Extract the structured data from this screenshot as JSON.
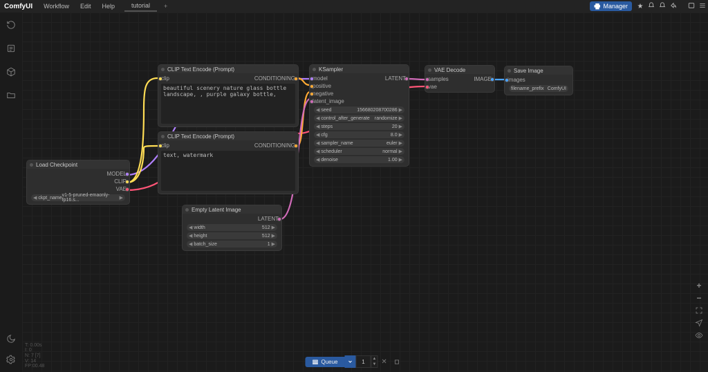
{
  "menu": {
    "logo": "ComfyUI",
    "items": [
      "Workflow",
      "Edit",
      "Help"
    ],
    "tab": "tutorial",
    "manager": "Manager"
  },
  "sidebar": {},
  "nodes": {
    "ckpt": {
      "title": "Load Checkpoint",
      "outputs": [
        "MODEL",
        "CLIP",
        "VAE"
      ],
      "widget": {
        "label": "ckpt_name",
        "value": "v1-5-pruned-emaonly-fp16.s..."
      }
    },
    "clip1": {
      "title": "CLIP Text Encode (Prompt)",
      "in_label": "clip",
      "out_label": "CONDITIONING",
      "text": "beautiful scenery nature glass bottle landscape, , purple galaxy bottle,"
    },
    "clip2": {
      "title": "CLIP Text Encode (Prompt)",
      "in_label": "clip",
      "out_label": "CONDITIONING",
      "text": "text, watermark"
    },
    "empty": {
      "title": "Empty Latent Image",
      "out_label": "LATENT",
      "widgets": [
        {
          "label": "width",
          "value": "512"
        },
        {
          "label": "height",
          "value": "512"
        },
        {
          "label": "batch_size",
          "value": "1"
        }
      ]
    },
    "ksampler": {
      "title": "KSampler",
      "inputs": [
        "model",
        "positive",
        "negative",
        "latent_image"
      ],
      "out_label": "LATENT",
      "widgets": [
        {
          "label": "seed",
          "value": "156680208700286"
        },
        {
          "label": "control_after_generate",
          "value": "randomize"
        },
        {
          "label": "steps",
          "value": "20"
        },
        {
          "label": "cfg",
          "value": "8.0"
        },
        {
          "label": "sampler_name",
          "value": "euler"
        },
        {
          "label": "scheduler",
          "value": "normal"
        },
        {
          "label": "denoise",
          "value": "1.00"
        }
      ]
    },
    "vaedecode": {
      "title": "VAE Decode",
      "inputs": [
        "samples",
        "vae"
      ],
      "out_label": "IMAGE"
    },
    "save": {
      "title": "Save Image",
      "in_label": "images",
      "widget": {
        "label": "filename_prefix",
        "value": "ComfyUI"
      }
    }
  },
  "chart_data": {
    "type": "node-graph",
    "edges": [
      {
        "from": "ckpt.MODEL",
        "to": "ksampler.model",
        "color": "model"
      },
      {
        "from": "ckpt.CLIP",
        "to": "clip1.clip",
        "color": "clip"
      },
      {
        "from": "ckpt.CLIP",
        "to": "clip2.clip",
        "color": "clip"
      },
      {
        "from": "ckpt.VAE",
        "to": "vaedecode.vae",
        "color": "vae"
      },
      {
        "from": "clip1.CONDITIONING",
        "to": "ksampler.positive",
        "color": "cond"
      },
      {
        "from": "clip2.CONDITIONING",
        "to": "ksampler.negative",
        "color": "cond"
      },
      {
        "from": "empty.LATENT",
        "to": "ksampler.latent_image",
        "color": "latent"
      },
      {
        "from": "ksampler.LATENT",
        "to": "vaedecode.samples",
        "color": "latent"
      },
      {
        "from": "vaedecode.IMAGE",
        "to": "save.images",
        "color": "image"
      }
    ]
  },
  "queue": {
    "label": "Queue",
    "count": "1"
  },
  "hud": {
    "l1": "T: 0.00s",
    "l2": "I: 0",
    "l3": "N: 7 [7]",
    "l4": "V: 14",
    "l5": "FP:00.48"
  }
}
